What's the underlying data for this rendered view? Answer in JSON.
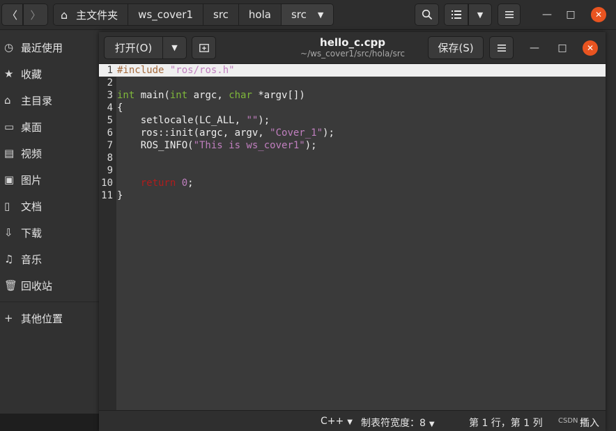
{
  "file_manager": {
    "nav_back_icon": "chevron-left-icon",
    "nav_forward_icon": "chevron-right-icon",
    "breadcrumbs": [
      {
        "label": "主文件夹",
        "icon": "home-icon"
      },
      {
        "label": "ws_cover1"
      },
      {
        "label": "src"
      },
      {
        "label": "hola"
      },
      {
        "label": "src",
        "active": true
      }
    ],
    "sidebar": [
      {
        "label": "最近使用",
        "icon": "clock-icon"
      },
      {
        "label": "收藏",
        "icon": "star-icon"
      },
      {
        "label": "主目录",
        "icon": "home-icon"
      },
      {
        "label": "桌面",
        "icon": "desktop-icon"
      },
      {
        "label": "视频",
        "icon": "film-icon"
      },
      {
        "label": "图片",
        "icon": "image-icon"
      },
      {
        "label": "文档",
        "icon": "document-icon"
      },
      {
        "label": "下载",
        "icon": "download-icon"
      },
      {
        "label": "音乐",
        "icon": "music-icon"
      },
      {
        "label": "回收站",
        "icon": "trash-icon"
      },
      {
        "label": "其他位置",
        "icon": "plus-icon"
      }
    ]
  },
  "editor": {
    "open_label": "打开(O)",
    "save_label": "保存(S)",
    "title": "hello_c.cpp",
    "subtitle": "~/ws_cover1/src/hola/src",
    "current_line": 1,
    "lines": [
      "#include \"ros/ros.h\"",
      "",
      "int main(int argc, char *argv[])",
      "{",
      "    setlocale(LC_ALL, \"\");",
      "    ros::init(argc, argv, \"Cover_1\");",
      "    ROS_INFO(\"This is ws_cover1\");",
      "",
      "",
      "    return 0;",
      "}"
    ],
    "status": {
      "language": "C++",
      "tab_width": "制表符宽度：8",
      "position": "第 1 行，第 1 列",
      "mode": "插入",
      "watermark": "CSDN @"
    }
  },
  "colors": {
    "accent_close": "#e95420",
    "current_line_bg": "#efefef",
    "code_bg": "#3a3a3a",
    "string": "#c07fbf",
    "type": "#7fb83a",
    "keyword": "#b11c1c",
    "preprocessor": "#a46a3c"
  }
}
